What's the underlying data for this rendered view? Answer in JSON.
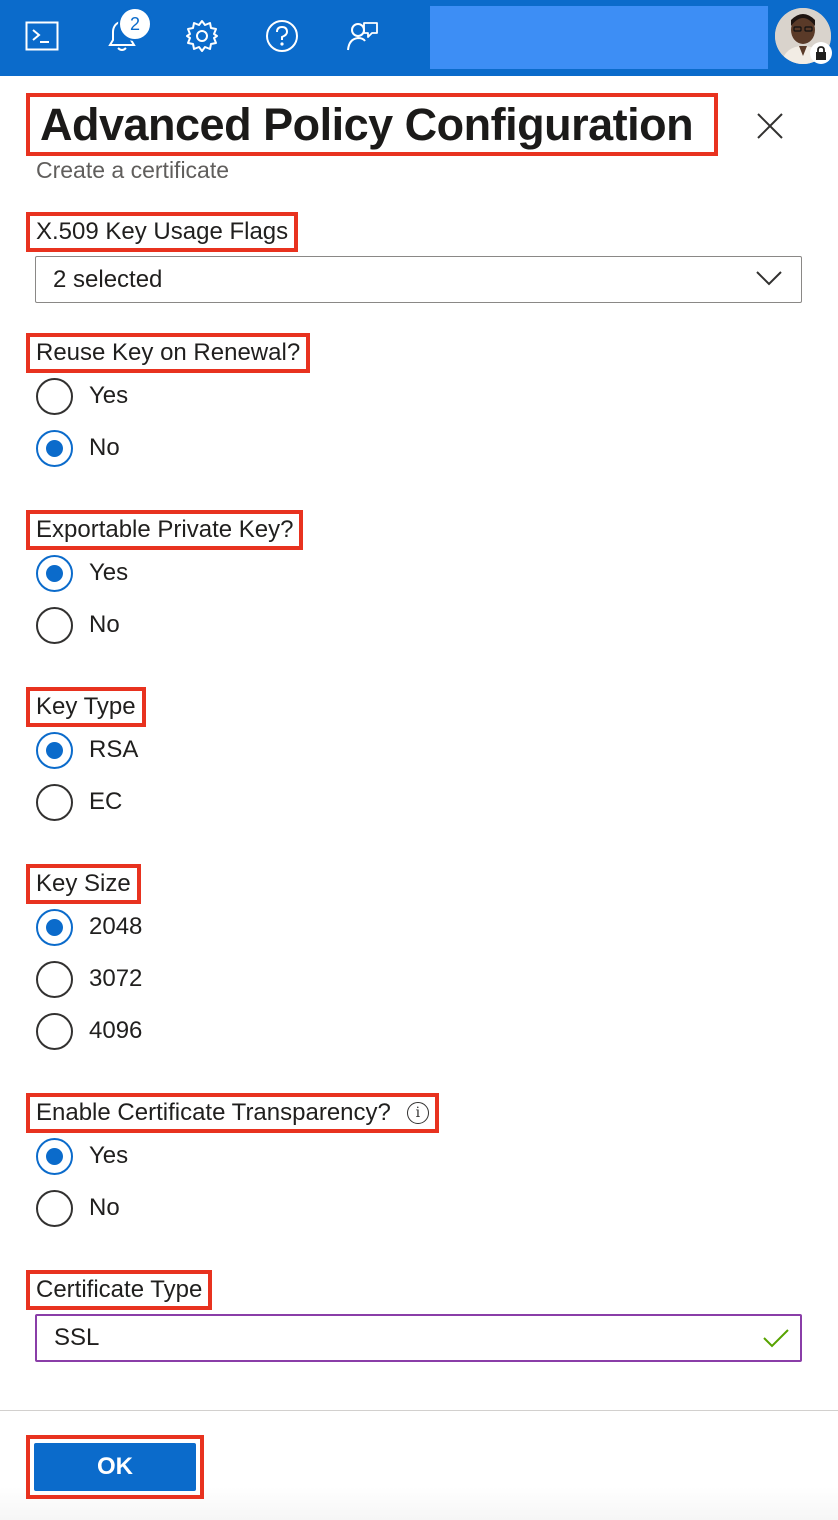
{
  "header": {
    "notification_count": "2",
    "icons": [
      "cloud-shell-icon",
      "notifications-bell-icon",
      "settings-gear-icon",
      "help-question-icon",
      "feedback-icon"
    ],
    "brand_color": "#0b6bcb"
  },
  "panel": {
    "title": "Advanced Policy Configuration",
    "subtitle": "Create a certificate",
    "close_icon": "close-icon"
  },
  "key_usage": {
    "label": "X.509 Key Usage Flags",
    "value": "2 selected"
  },
  "reuse_key": {
    "label": "Reuse Key on Renewal?",
    "options": [
      {
        "label": "Yes",
        "checked": false
      },
      {
        "label": "No",
        "checked": true
      }
    ]
  },
  "exportable_key": {
    "label": "Exportable Private Key?",
    "options": [
      {
        "label": "Yes",
        "checked": true
      },
      {
        "label": "No",
        "checked": false
      }
    ]
  },
  "key_type": {
    "label": "Key Type",
    "options": [
      {
        "label": "RSA",
        "checked": true
      },
      {
        "label": "EC",
        "checked": false
      }
    ]
  },
  "key_size": {
    "label": "Key Size",
    "options": [
      {
        "label": "2048",
        "checked": true
      },
      {
        "label": "3072",
        "checked": false
      },
      {
        "label": "4096",
        "checked": false
      }
    ]
  },
  "cert_transparency": {
    "label": "Enable Certificate Transparency?",
    "info_icon": "i",
    "options": [
      {
        "label": "Yes",
        "checked": true
      },
      {
        "label": "No",
        "checked": false
      }
    ]
  },
  "cert_type": {
    "label": "Certificate Type",
    "value": "SSL",
    "valid": true
  },
  "footer": {
    "ok_label": "OK"
  },
  "colors": {
    "highlight": "#e8321f",
    "accent": "#0b6bcb",
    "valid_check": "#57a300"
  }
}
